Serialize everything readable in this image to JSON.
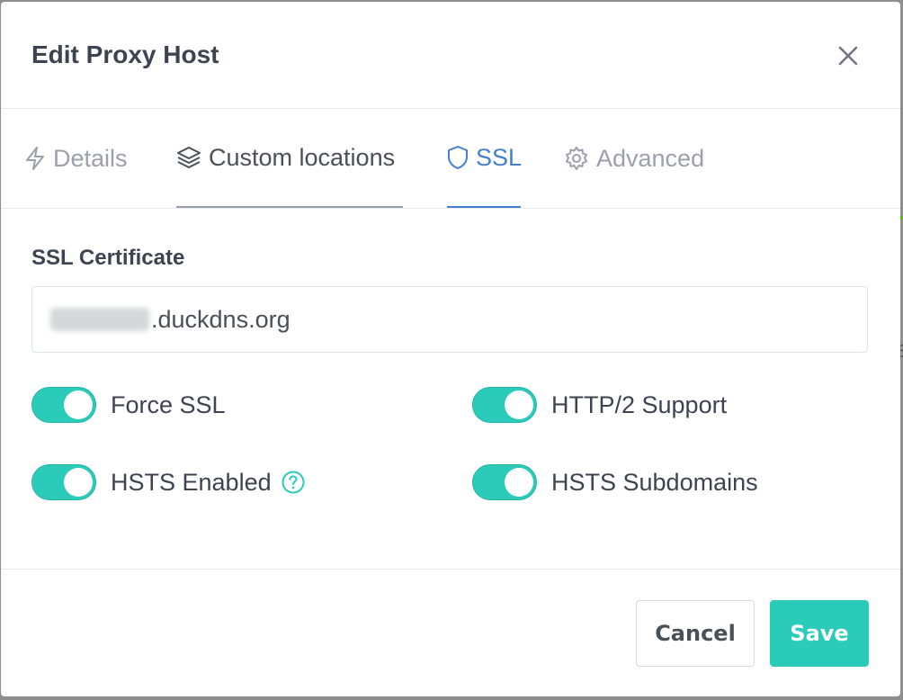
{
  "modal": {
    "title": "Edit Proxy Host",
    "close_icon": "close-icon"
  },
  "tabs": [
    {
      "label": "Details",
      "icon": "lightning-icon",
      "state": "inactive"
    },
    {
      "label": "Custom locations",
      "icon": "layers-icon",
      "state": "visited"
    },
    {
      "label": "SSL",
      "icon": "shield-icon",
      "state": "active"
    },
    {
      "label": "Advanced",
      "icon": "gear-icon",
      "state": "inactive"
    }
  ],
  "ssl": {
    "section_label": "SSL Certificate",
    "certificate": {
      "value_suffix": ".duckdns.org",
      "value_prefix_redacted": true
    },
    "toggles": [
      {
        "label": "Force SSL",
        "on": true
      },
      {
        "label": "HTTP/2 Support",
        "on": true
      },
      {
        "label": "HSTS Enabled",
        "on": true,
        "help_icon": "help-circle-icon"
      },
      {
        "label": "HSTS Subdomains",
        "on": true
      }
    ]
  },
  "footer": {
    "cancel_label": "Cancel",
    "save_label": "Save"
  },
  "colors": {
    "accent_teal": "#2bcbba",
    "active_tab_blue": "#467fcf",
    "muted_text": "#9aa0ac",
    "title_text": "#3d4451"
  }
}
